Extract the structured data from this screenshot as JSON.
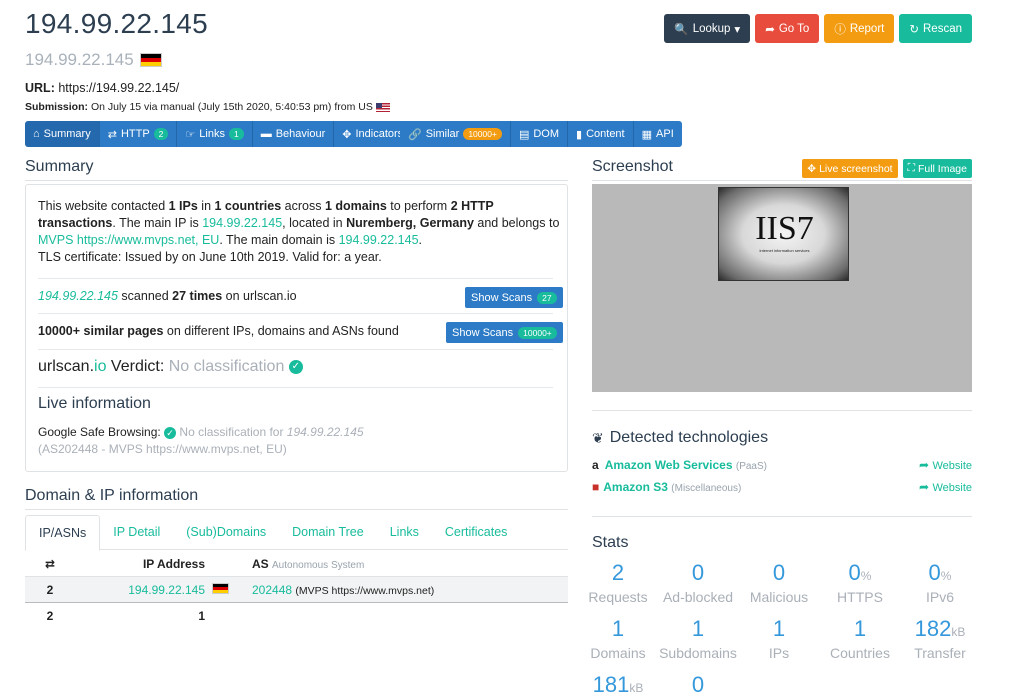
{
  "header": {
    "title": "194.99.22.145",
    "subtitle_ip": "194.99.22.145",
    "url_label": "URL:",
    "url_value": "https://194.99.22.145/",
    "submission_label": "Submission:",
    "submission_value": "On July 15 via manual (July 15th 2020, 5:40:53 pm) from US"
  },
  "top_buttons": {
    "lookup": "Lookup",
    "goto": "Go To",
    "report": "Report",
    "rescan": "Rescan"
  },
  "nav": {
    "summary": "Summary",
    "http": "HTTP",
    "http_count": "2",
    "links": "Links",
    "links_count": "1",
    "behaviour": "Behaviour",
    "indicators": "Indicators",
    "similar": "Similar",
    "similar_count": "10000+",
    "dom": "DOM",
    "content": "Content",
    "api": "API"
  },
  "summary": {
    "heading": "Summary",
    "p1": "This website contacted ",
    "p1_ips": "1 IPs",
    "p1_in": " in ",
    "p1_countries": "1 countries",
    "p1_across": " across ",
    "p1_domains": "1 domains",
    "p1_perform": " to perform ",
    "p1_http": "2 HTTP transactions",
    "p1_mainip": ". The main IP is ",
    "main_ip": "194.99.22.145",
    "p1_located": ", located in ",
    "location": "Nuremberg, Germany",
    "p1_belongs": " and belongs to ",
    "asn_link": "MVPS https://www.mvps.net, EU",
    "p1_maindomain": ". The main domain is ",
    "main_domain": "194.99.22.145",
    "p1_end": ".",
    "tls": "TLS certificate: Issued by  on June 10th 2019. Valid for: a year.",
    "scanned_ip": "194.99.22.145",
    "scanned_text": " scanned ",
    "scanned_times": "27 times",
    "scanned_on": " on urlscan.io",
    "show_scans_1": "Show Scans",
    "show_scans_1_count": "27",
    "similar_bold": "10000+ similar pages",
    "similar_rest": " on different IPs, domains and ASNs found",
    "show_scans_2": "Show Scans",
    "show_scans_2_count": "10000+",
    "verdict_a": "urlscan.",
    "verdict_io": "io",
    "verdict_b": " Verdict: ",
    "verdict_value": "No classification",
    "live_heading": "Live information",
    "gsb_label": "Google Safe Browsing: ",
    "gsb_value": "No classification for ",
    "gsb_ip": "194.99.22.145",
    "gsb_asn": "(AS202448 - MVPS https://www.mvps.net, EU)"
  },
  "domain_ip": {
    "heading": "Domain & IP information",
    "tabs": [
      "IP/ASNs",
      "IP Detail",
      "(Sub)Domains",
      "Domain Tree",
      "Links",
      "Certificates"
    ],
    "col_ip": "IP Address",
    "col_as": "AS",
    "col_as_sub": "Autonomous System",
    "row1": {
      "count": "2",
      "ip": "194.99.22.145",
      "as": "202448",
      "as_name": "(MVPS https://www.mvps.net)"
    },
    "row2": {
      "count": "2",
      "ip_count": "1"
    }
  },
  "screenshot": {
    "heading": "Screenshot",
    "live_btn": "Live screenshot",
    "full_btn": "Full Image",
    "iis_text": "IIS7",
    "iis_sub": "internet information services"
  },
  "technologies": {
    "heading": "Detected technologies",
    "items": [
      {
        "name": "Amazon Web Services",
        "category": "(PaaS)",
        "link": "Website"
      },
      {
        "name": "Amazon S3",
        "category": "(Miscellaneous)",
        "link": "Website"
      }
    ]
  },
  "stats": {
    "heading": "Stats",
    "items": [
      {
        "value": "2",
        "unit": "",
        "label": "Requests"
      },
      {
        "value": "0",
        "unit": "",
        "label": "Ad-blocked"
      },
      {
        "value": "0",
        "unit": "",
        "label": "Malicious"
      },
      {
        "value": "0",
        "unit": "%",
        "label": "HTTPS"
      },
      {
        "value": "0",
        "unit": "%",
        "label": "IPv6"
      },
      {
        "value": "1",
        "unit": "",
        "label": "Domains"
      },
      {
        "value": "1",
        "unit": "",
        "label": "Subdomains"
      },
      {
        "value": "1",
        "unit": "",
        "label": "IPs"
      },
      {
        "value": "1",
        "unit": "",
        "label": "Countries"
      },
      {
        "value": "182",
        "unit": "kB",
        "label": "Transfer"
      },
      {
        "value": "181",
        "unit": "kB",
        "label": ""
      },
      {
        "value": "0",
        "unit": "",
        "label": ""
      }
    ]
  }
}
